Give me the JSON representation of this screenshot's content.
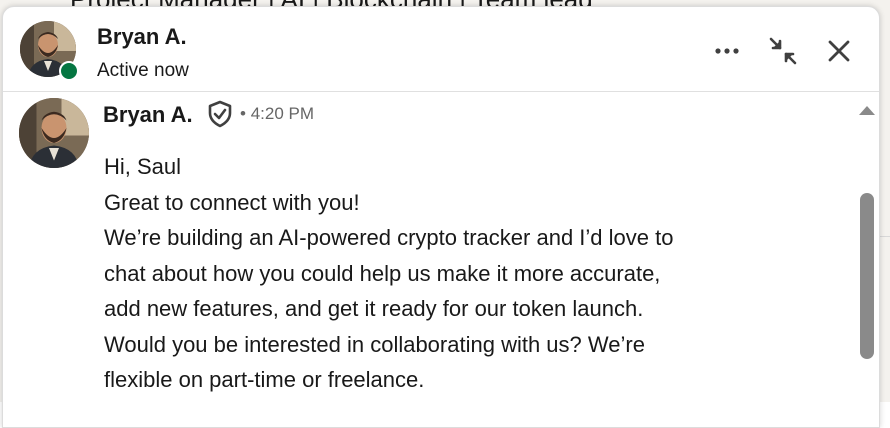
{
  "background": {
    "top_text": "Project Manager | AI | Blockchain | Team lead",
    "right_char": "i"
  },
  "header": {
    "name": "Bryan A.",
    "status": "Active now",
    "presence_color": "#057642"
  },
  "message": {
    "sender": "Bryan A.",
    "separator": "•",
    "time": "4:20 PM",
    "lines": [
      "Hi, Saul",
      "Great to connect with you!",
      "We’re building an AI-powered crypto tracker and I’d love to",
      "chat about how you could help us make it more accurate,",
      "add new features, and get it ready for our token launch.",
      "Would you be interested in collaborating with us? We’re",
      "flexible on part-time or freelance."
    ]
  },
  "icons": {
    "more": "more-horizontal-icon",
    "minimize": "minimize-arrows-icon",
    "close": "close-icon",
    "verified": "verified-shield-icon",
    "scroll_up": "caret-up-icon"
  }
}
